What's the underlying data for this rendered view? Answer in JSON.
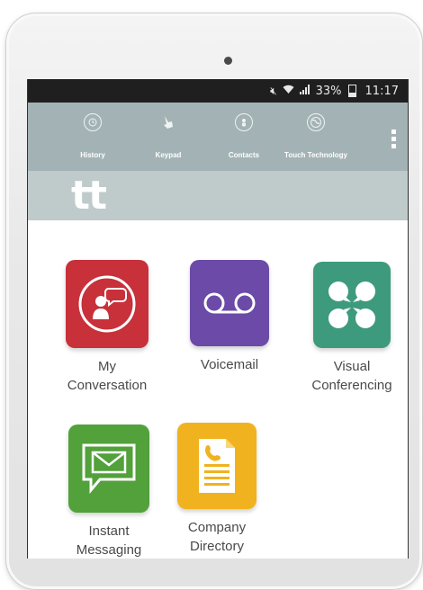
{
  "status_bar": {
    "battery": "33%",
    "time": "11:17",
    "icons": [
      "mute-icon",
      "wifi-icon",
      "signal-icon",
      "battery-icon"
    ]
  },
  "nav": {
    "items": [
      {
        "label": "History",
        "icon": "history-icon"
      },
      {
        "label": "Keypad",
        "icon": "keypad-icon"
      },
      {
        "label": "Contacts",
        "icon": "contacts-icon"
      },
      {
        "label": "Touch Technology",
        "icon": "globe-icon"
      }
    ],
    "menu_icon": "overflow-menu-icon"
  },
  "brand": {
    "logo": "tt"
  },
  "tiles": [
    {
      "line1": "My",
      "line2": "Conversation",
      "color": "#c8303a",
      "icon": "conversation-icon"
    },
    {
      "line1": "Voicemail",
      "line2": "",
      "color": "#6b4aa8",
      "icon": "voicemail-icon"
    },
    {
      "line1": "Visual",
      "line2": "Conferencing",
      "color": "#3e9a7d",
      "icon": "conferencing-icon"
    },
    {
      "line1": "Instant",
      "line2": "Messaging",
      "color": "#52a13a",
      "icon": "message-icon"
    },
    {
      "line1": "Company",
      "line2": "Directory",
      "color": "#f0b21e",
      "icon": "directory-icon"
    }
  ],
  "colors": {
    "status_bar_bg": "#1f1f1f",
    "nav_bg": "#a3b3b5",
    "brand_bg": "#bfcacb"
  }
}
